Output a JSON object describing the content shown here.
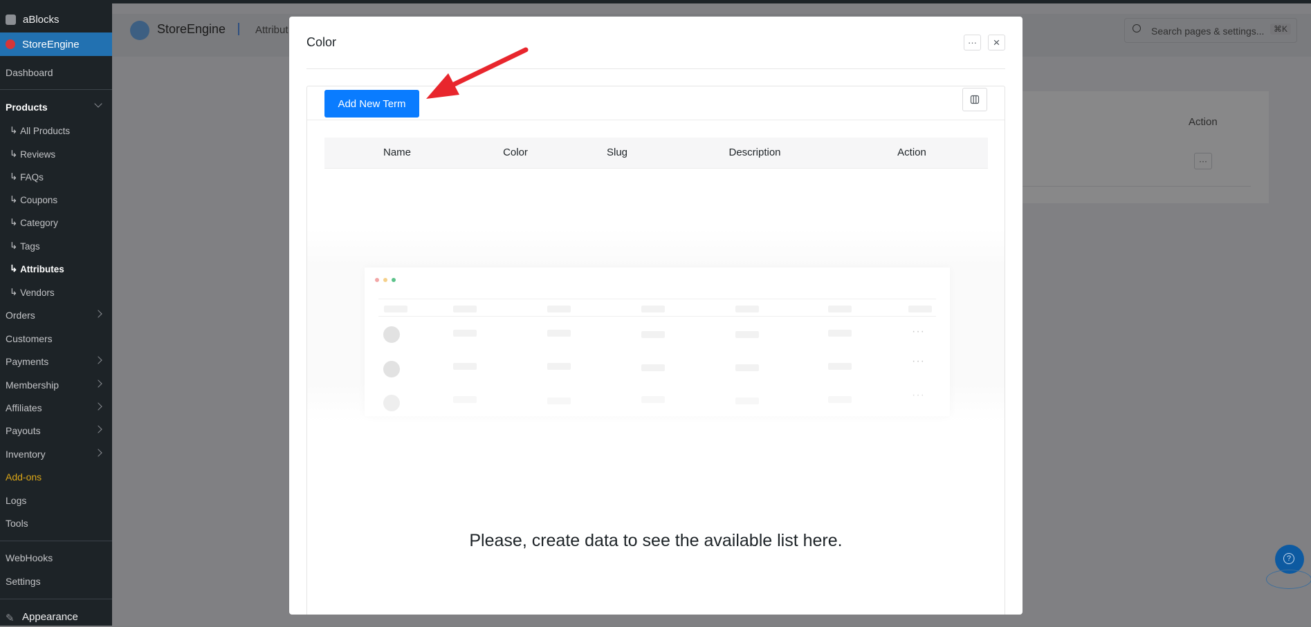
{
  "sidebar": {
    "site": "aBlocks",
    "plugin": "StoreEngine",
    "items": [
      {
        "label": "Dashboard"
      },
      {
        "label": "Products"
      },
      {
        "label": "All Products"
      },
      {
        "label": "Reviews"
      },
      {
        "label": "FAQs"
      },
      {
        "label": "Coupons"
      },
      {
        "label": "Category"
      },
      {
        "label": "Tags"
      },
      {
        "label": "Attributes"
      },
      {
        "label": "Vendors"
      },
      {
        "label": "Orders"
      },
      {
        "label": "Customers"
      },
      {
        "label": "Payments"
      },
      {
        "label": "Membership"
      },
      {
        "label": "Affiliates"
      },
      {
        "label": "Payouts"
      },
      {
        "label": "Inventory"
      },
      {
        "label": "Add-ons"
      },
      {
        "label": "Logs"
      },
      {
        "label": "Tools"
      },
      {
        "label": "WebHooks"
      },
      {
        "label": "Settings"
      },
      {
        "label": "Appearance"
      }
    ]
  },
  "header": {
    "brand": "StoreEngine",
    "breadcrumb": "Attribut",
    "search_placeholder": "Search pages & settings...",
    "search_shortcut": "⌘K",
    "bg_action_label": "Action",
    "bg_action_button": "···"
  },
  "modal": {
    "title": "Color",
    "more_button": "···",
    "close_button": "×",
    "add_button": "Add New Term",
    "columns": [
      "Name",
      "Color",
      "Slug",
      "Description",
      "Action"
    ],
    "empty_message": "Please, create data to see the available list here."
  },
  "colors": {
    "sidebar_bg": "#1d2327",
    "accent_active": "#2271b1",
    "primary_button": "#0a7cff",
    "addons_text": "#dba617",
    "arrow": "#e8262d"
  }
}
